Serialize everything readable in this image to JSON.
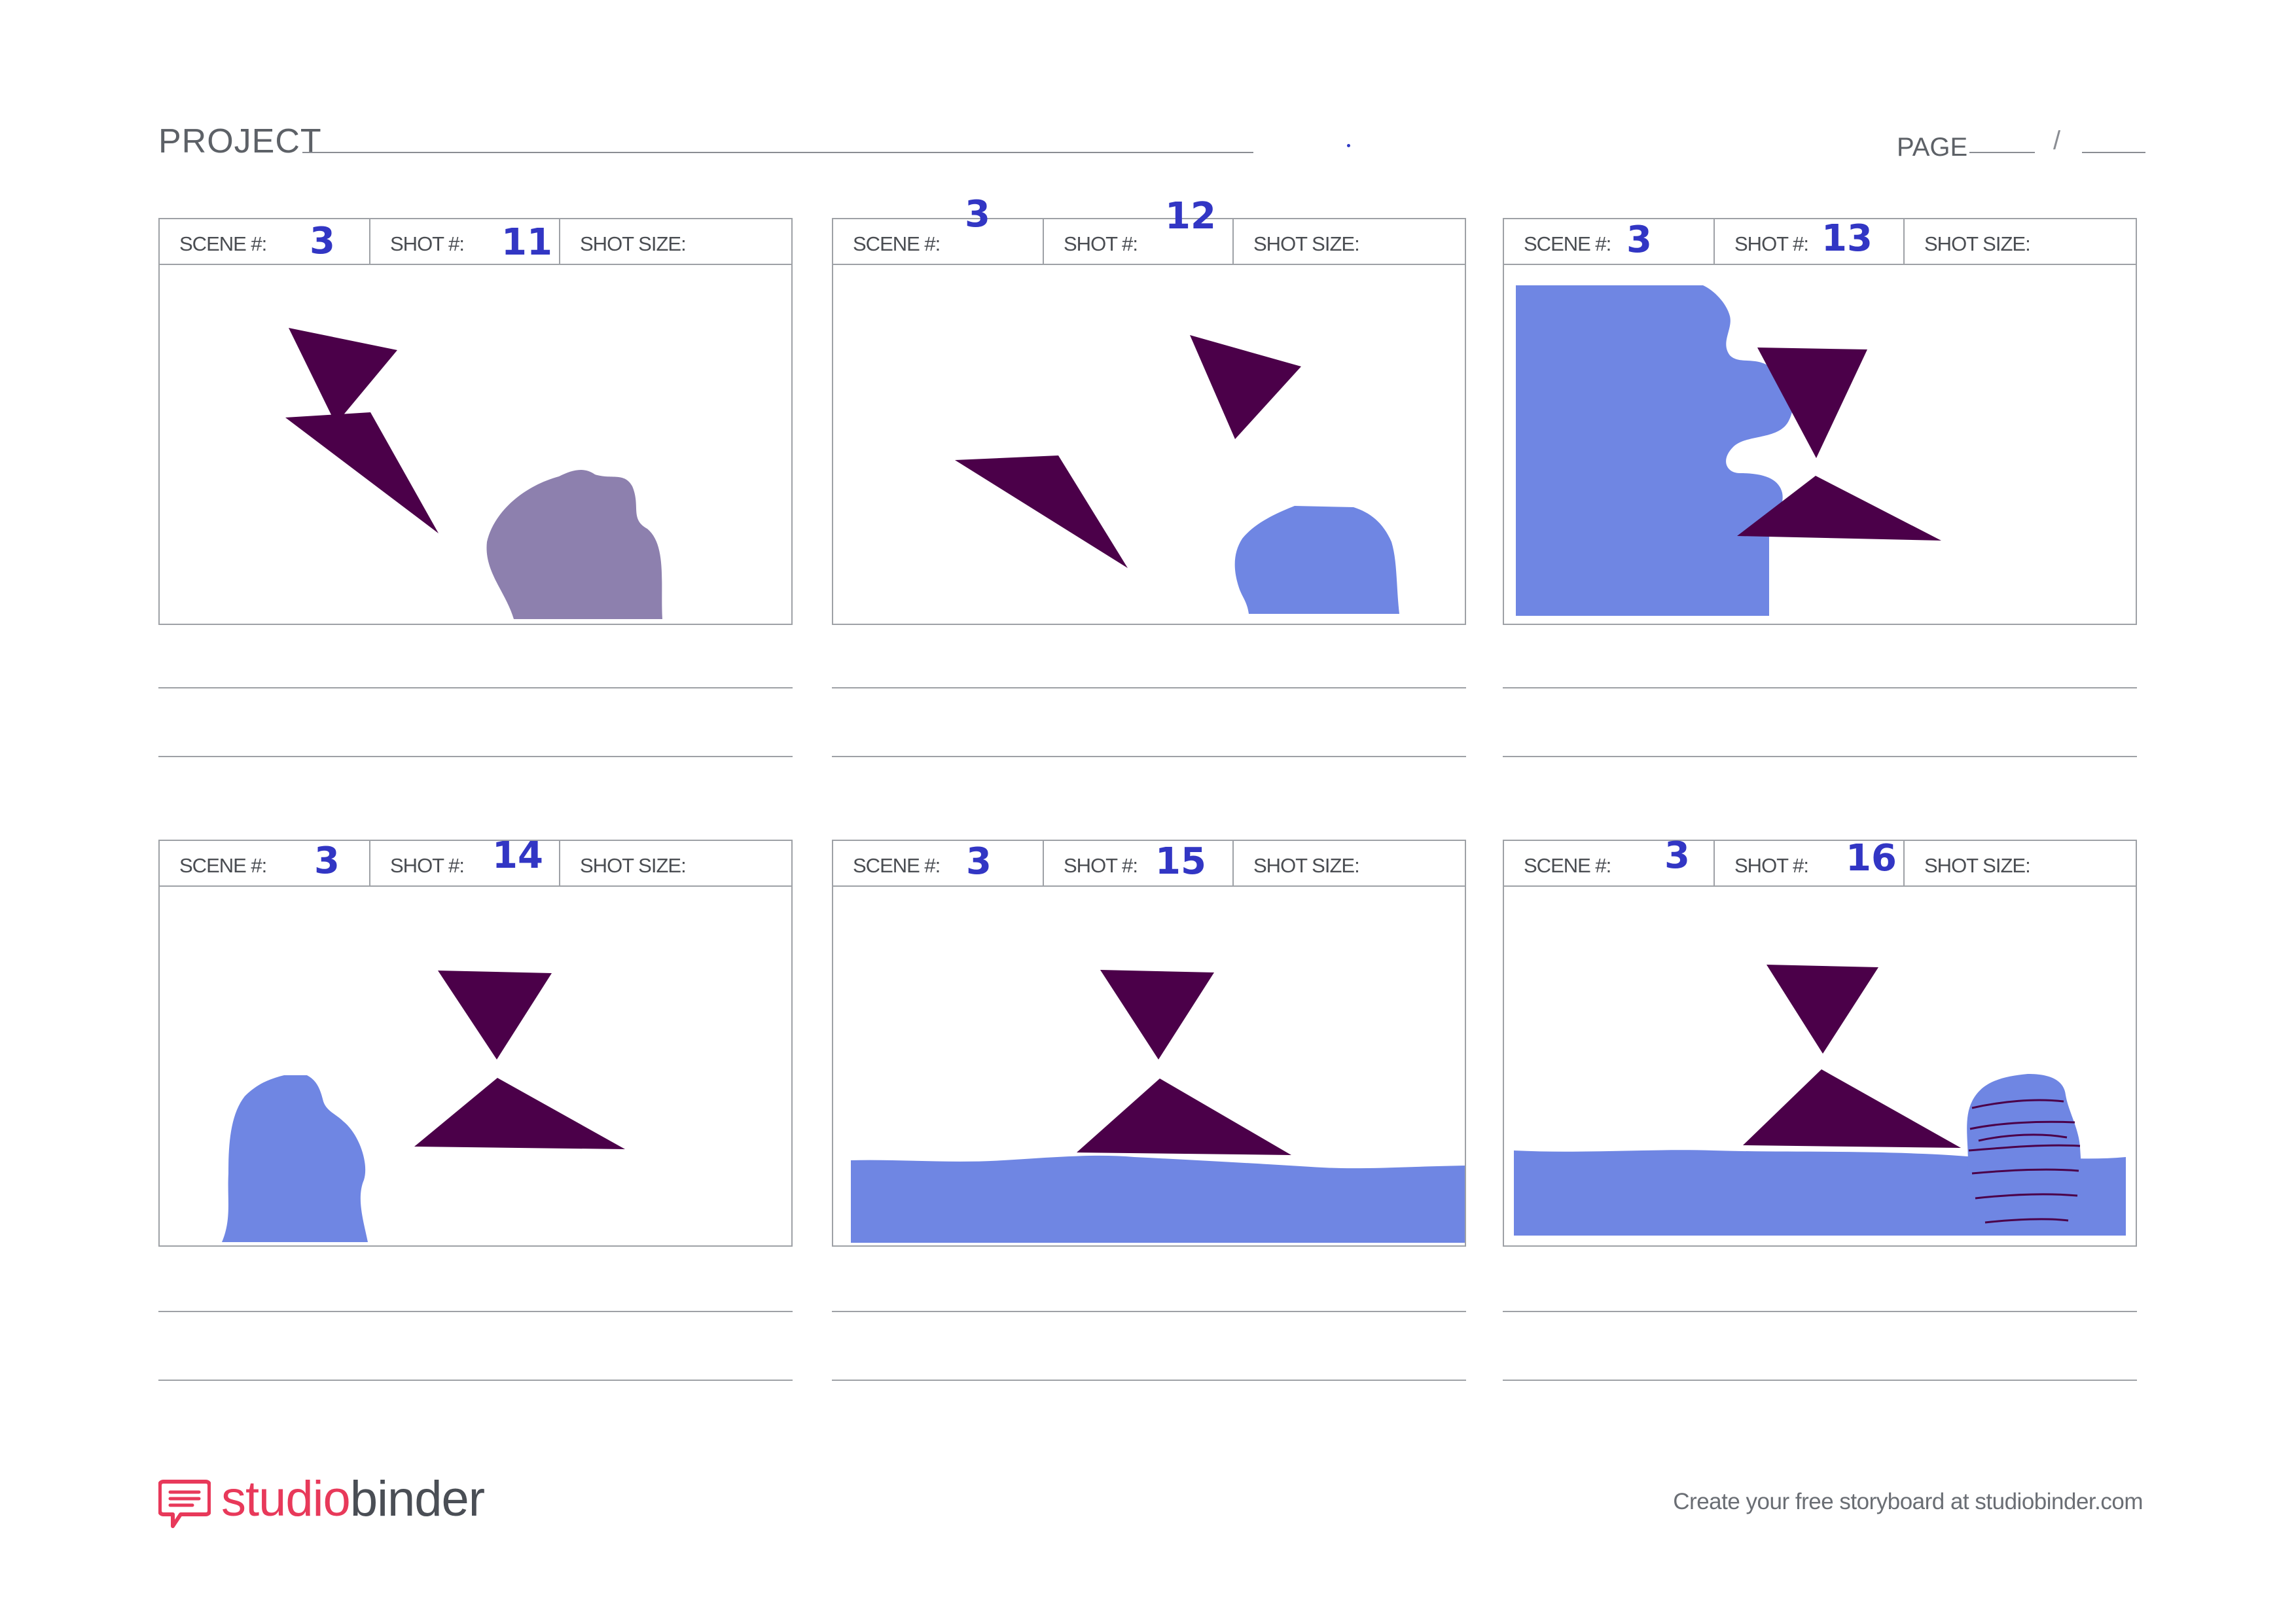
{
  "header": {
    "project_label": "PROJECT",
    "page_label": "PAGE",
    "page_separator": "/"
  },
  "panels": [
    {
      "scene_label": "SCENE #:",
      "scene": "3",
      "shot_label": "SHOT #:",
      "shot": "11",
      "size_label": "SHOT SIZE:"
    },
    {
      "scene_label": "SCENE #:",
      "scene": "3",
      "shot_label": "SHOT #:",
      "shot": "12",
      "size_label": "SHOT SIZE:"
    },
    {
      "scene_label": "SCENE #:",
      "scene": "3",
      "shot_label": "SHOT #:",
      "shot": "13",
      "size_label": "SHOT SIZE:"
    },
    {
      "scene_label": "SCENE #:",
      "scene": "3",
      "shot_label": "SHOT #:",
      "shot": "14",
      "size_label": "SHOT SIZE:"
    },
    {
      "scene_label": "SCENE #:",
      "scene": "3",
      "shot_label": "SHOT #:",
      "shot": "15",
      "size_label": "SHOT SIZE:"
    },
    {
      "scene_label": "SCENE #:",
      "scene": "3",
      "shot_label": "SHOT #:",
      "shot": "16",
      "size_label": "SHOT SIZE:"
    }
  ],
  "footer": {
    "logo_part1": "studio",
    "logo_part2": "binder",
    "tagline": "Create your free storyboard at studiobinder.com"
  },
  "colors": {
    "triangle": "#4b0049",
    "shape_blue": "#6f86e3",
    "shape_gray_purple": "#8d80ae",
    "number_blue": "#3236c4",
    "logo_pink": "#e8395a"
  }
}
